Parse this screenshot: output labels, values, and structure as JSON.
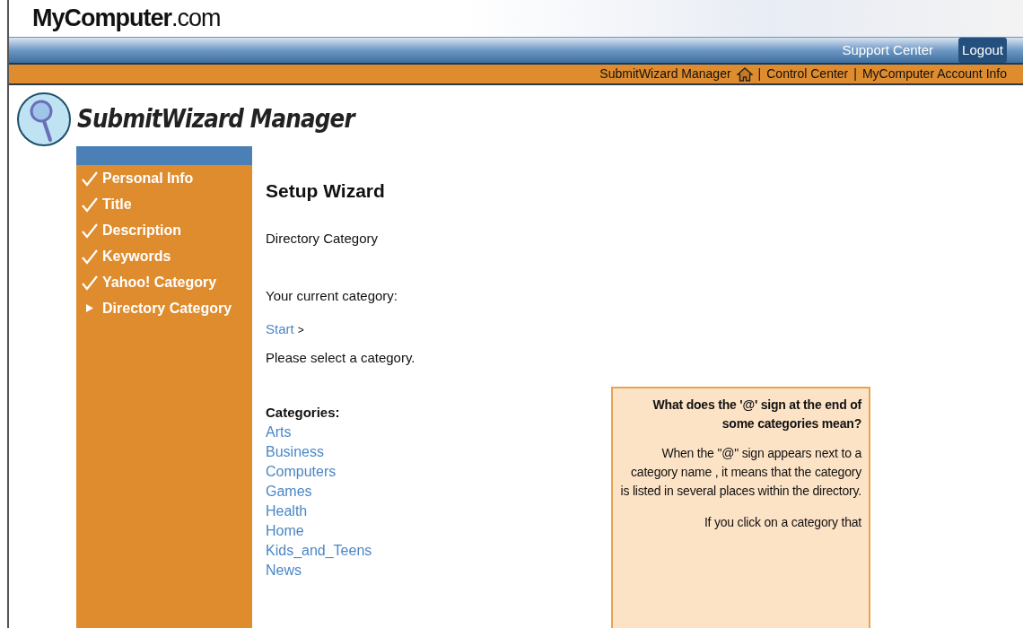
{
  "header": {
    "logo": "**MyComputer**.com",
    "links": [
      {
        "label": "Support Center",
        "button": false
      },
      {
        "label": "Logout",
        "button": true
      }
    ]
  },
  "nav": [
    {
      "label": "SubmitWizard Manager",
      "home": true
    },
    {
      "label": "Control Center",
      "home": false,
      "prefix": "|"
    },
    {
      "label": "MyComputer Account Info",
      "home": false,
      "prefix": "|"
    }
  ],
  "app_title": "SubmitWizard Manager",
  "steps": [
    {
      "label": "Personal Info",
      "done": true
    },
    {
      "label": "Title",
      "done": true
    },
    {
      "label": "Description",
      "done": true
    },
    {
      "label": "Keywords",
      "done": true
    },
    {
      "label": "Yahoo! Category",
      "done": true
    },
    {
      "label": "Directory Category",
      "done": false
    }
  ],
  "content": {
    "heading": "Setup Wizard",
    "subheading": "Directory Category",
    "current_label": "Your current category:",
    "breadcrumb": [
      {
        "label": "Start",
        "separator": ">"
      }
    ],
    "instruction": "Please select a category.",
    "categories_label": "Categories:",
    "categories": [
      "Arts",
      "Business",
      "Computers",
      "Games",
      "Health",
      "Home",
      "Kids_and_Teens",
      "News"
    ]
  },
  "help": {
    "title": "What does the '@' sign at the end of some categories mean?",
    "paragraphs": [
      "When the \"@\" sign appears next to a category name , it means that the category is listed in several places within the directory.",
      "If you click on a category that"
    ]
  }
}
